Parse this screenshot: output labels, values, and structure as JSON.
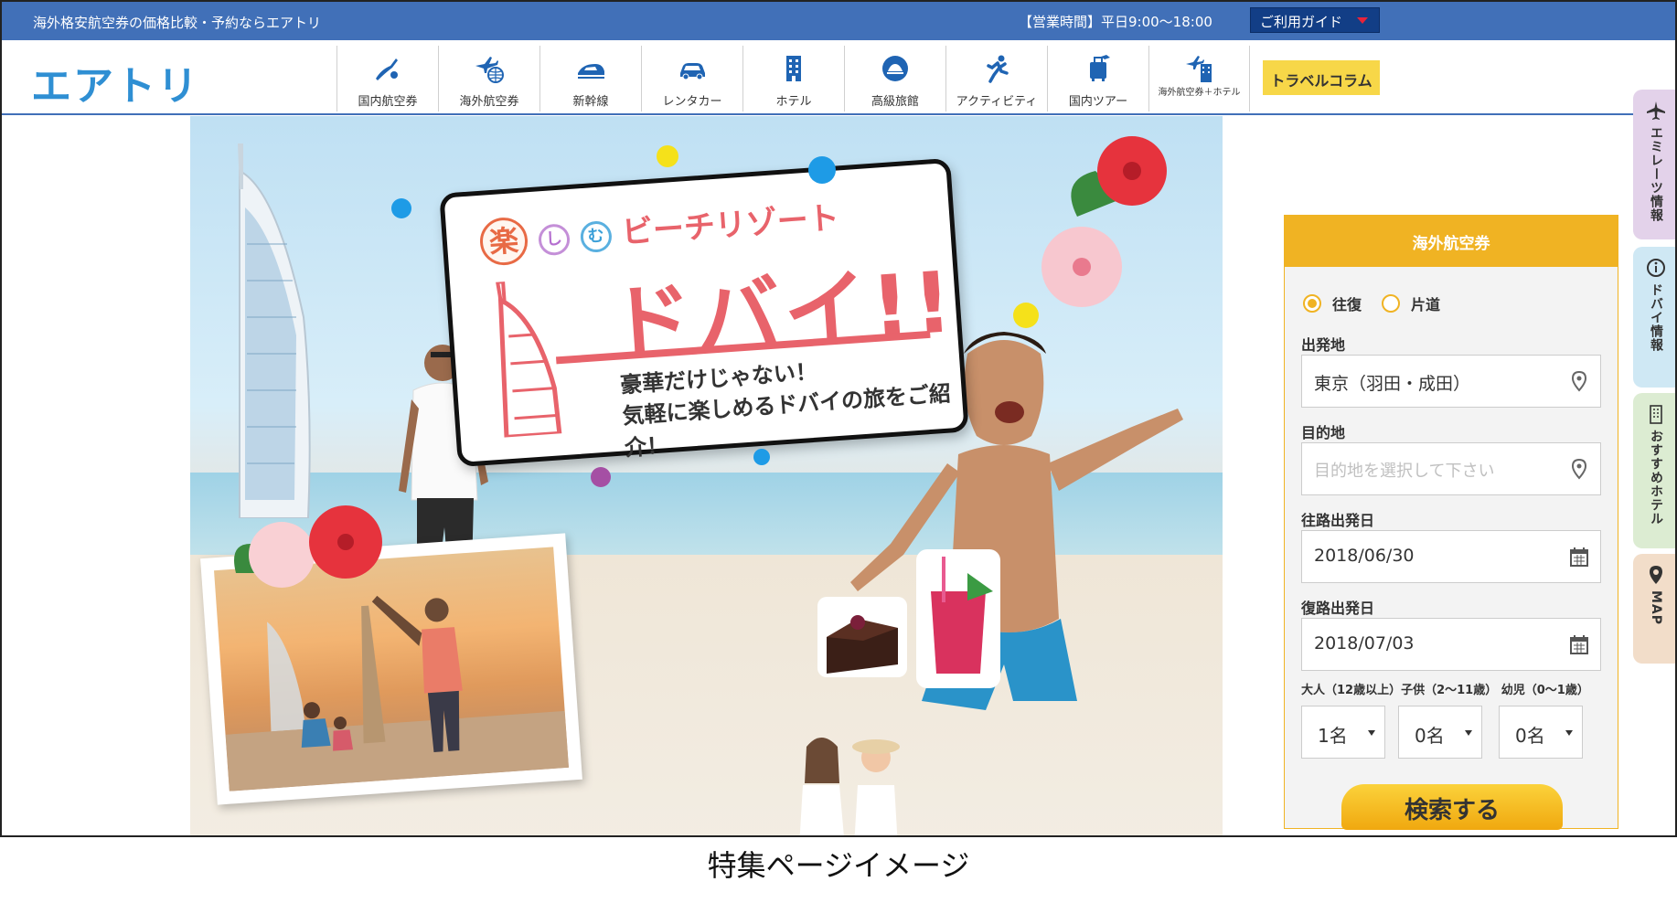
{
  "topbar": {
    "tagline": "海外格安航空券の価格比較・予約ならエアトリ",
    "hours": "【営業時間】平日9:00～18:00",
    "guide_label": "ご利用ガイド"
  },
  "header": {
    "logo": "エアトリ",
    "nav": [
      {
        "label": "国内航空券",
        "icon": "domestic-flight-icon"
      },
      {
        "label": "海外航空券",
        "icon": "international-flight-icon"
      },
      {
        "label": "新幹線",
        "icon": "shinkansen-icon"
      },
      {
        "label": "レンタカー",
        "icon": "rental-car-icon"
      },
      {
        "label": "ホテル",
        "icon": "hotel-icon"
      },
      {
        "label": "高級旅館",
        "icon": "luxury-inn-icon"
      },
      {
        "label": "アクティビティ",
        "icon": "activity-icon"
      },
      {
        "label": "国内ツアー",
        "icon": "domestic-tour-icon"
      },
      {
        "label": "海外航空券＋ホテル",
        "icon": "flight-hotel-icon"
      }
    ],
    "column_label": "トラベルコラム"
  },
  "hero": {
    "subtitle_raku": "楽",
    "subtitle_shi": "し",
    "subtitle_mu": "む",
    "subtitle_rest": "ビーチリゾート",
    "title": "ドバイ!!",
    "desc_line1": "豪華だけじゃない！",
    "desc_line2": "気軽に楽しめるドバイの旅をご紹介！"
  },
  "search": {
    "header": "海外航空券",
    "trip_roundtrip": "往復",
    "trip_oneway": "片道",
    "trip_selected": "往復",
    "origin_label": "出発地",
    "origin_value": "東京（羽田・成田）",
    "destination_label": "目的地",
    "destination_placeholder": "目的地を選択して下さい",
    "outbound_label": "往路出発日",
    "outbound_value": "2018/06/30",
    "return_label": "復路出発日",
    "return_value": "2018/07/03",
    "pax_label": "大人（12歳以上）子供（2～11歳） 幼児（0～1歳）",
    "adults": "1名",
    "children": "0名",
    "infants": "0名",
    "submit": "検索する"
  },
  "side_tabs": [
    {
      "label": "エミレーツ情報",
      "icon": "airplane-icon",
      "color": "#e3d2ea"
    },
    {
      "label": "ドバイ情報",
      "icon": "info-icon",
      "color": "#cfe8f4"
    },
    {
      "label": "おすすめホテル",
      "icon": "building-icon",
      "color": "#dcecd2"
    },
    {
      "label": "MAP",
      "icon": "map-pin-icon",
      "color": "#f2ddc9"
    }
  ],
  "caption": "特集ページイメージ",
  "colors": {
    "topbar": "#4170b8",
    "accent": "#f0b323",
    "title_pink": "#e8636b",
    "logo_blue": "#2f8fd3"
  }
}
